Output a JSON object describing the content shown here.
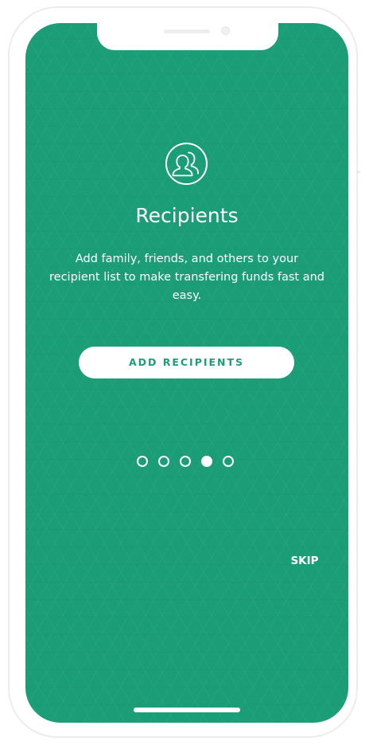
{
  "onboarding": {
    "icon": "people-icon",
    "title": "Recipients",
    "description": "Add family, friends, and others to your recipient list to make transfering funds fast and easy.",
    "add_button_label": "ADD RECIPIENTS",
    "skip_label": "SKIP"
  },
  "pagination": {
    "total_pages": 5,
    "active_page": 4
  },
  "colors": {
    "background": "#1b9e77",
    "accent": "#ffffff"
  }
}
